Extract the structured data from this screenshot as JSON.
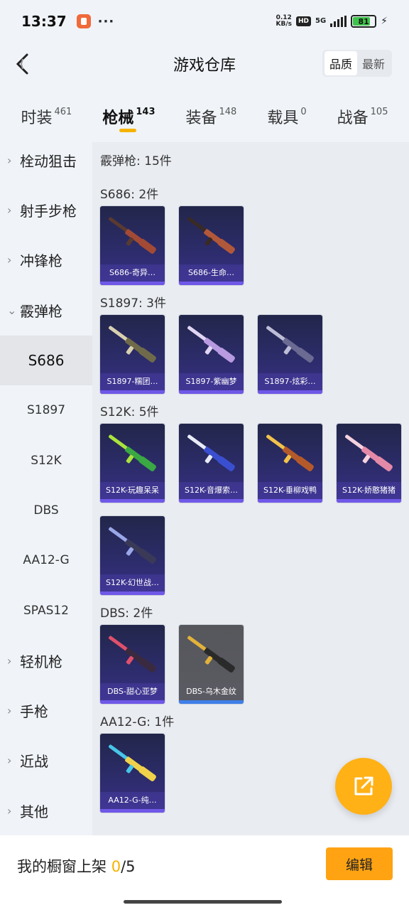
{
  "status_bar": {
    "time": "13:37",
    "dots": "···",
    "net_speed_value": "0.12",
    "net_speed_unit": "KB/s",
    "hd": "HD",
    "network": "5G",
    "battery": "81",
    "battery_level": 0.81,
    "bolt": "⚡"
  },
  "header": {
    "title": "游戏仓库",
    "sort_options": [
      "品质",
      "最新"
    ],
    "active_sort": 0
  },
  "tabs": [
    {
      "label": "时装",
      "count": "461"
    },
    {
      "label": "枪械",
      "count": "143"
    },
    {
      "label": "装备",
      "count": "148"
    },
    {
      "label": "载具",
      "count": "0"
    },
    {
      "label": "战备",
      "count": "105"
    }
  ],
  "sidebar": {
    "items": [
      {
        "label": "栓动狙击",
        "chevron": "›"
      },
      {
        "label": "射手步枪",
        "chevron": "›"
      },
      {
        "label": "冲锋枪",
        "chevron": "›"
      },
      {
        "label": "霰弹枪",
        "chevron": "⌄"
      },
      {
        "label": "S686"
      },
      {
        "label": "S1897"
      },
      {
        "label": "S12K"
      },
      {
        "label": "DBS"
      },
      {
        "label": "AA12-G"
      },
      {
        "label": "SPAS12"
      },
      {
        "label": "轻机枪",
        "chevron": "›"
      },
      {
        "label": "手枪",
        "chevron": "›"
      },
      {
        "label": "近战",
        "chevron": "›"
      },
      {
        "label": "其他",
        "chevron": "›"
      }
    ]
  },
  "content": {
    "category_heading": "霰弹枪: 15件",
    "groups": [
      {
        "heading": "S686: 2件",
        "items": [
          {
            "label": "S686-奇异…",
            "colors": [
              "#5a3a30",
              "#a24a35"
            ]
          },
          {
            "label": "S686-生命…",
            "colors": [
              "#3a2a24",
              "#b2583a"
            ]
          }
        ]
      },
      {
        "heading": "S1897: 3件",
        "items": [
          {
            "label": "S1897-糯团…",
            "colors": [
              "#d8d0b0",
              "#6f6a4a"
            ]
          },
          {
            "label": "S1897-紫幽梦",
            "colors": [
              "#e0d6f4",
              "#b89ae0"
            ]
          },
          {
            "label": "S1897-炫彩…",
            "colors": [
              "#bdbdd6",
              "#6b6a92"
            ]
          }
        ]
      },
      {
        "heading": "S12K: 5件",
        "items": [
          {
            "label": "S12K-玩趣呆呆",
            "colors": [
              "#a9e43c",
              "#3aa843"
            ]
          },
          {
            "label": "S12K-音爆索…",
            "colors": [
              "#e8ecf6",
              "#3a4fd0"
            ]
          },
          {
            "label": "S12K-垂柳戏鸭",
            "colors": [
              "#f2c24a",
              "#b45a2a"
            ]
          },
          {
            "label": "S12K-娇憨猪猪",
            "colors": [
              "#f6d2de",
              "#e48aa8"
            ]
          },
          {
            "label": "S12K-幻世战…",
            "colors": [
              "#9aa7e8",
              "#3a3a58"
            ]
          }
        ]
      },
      {
        "heading": "DBS: 2件",
        "items": [
          {
            "label": "DBS-甜心亚梦",
            "colors": [
              "#e0506a",
              "#3a2a40"
            ],
            "tone": "purple"
          },
          {
            "label": "DBS-乌木金纹",
            "colors": [
              "#e2b23a",
              "#2a2a2a"
            ],
            "tone": "gray"
          }
        ]
      },
      {
        "heading": "AA12-G: 1件",
        "items": [
          {
            "label": "AA12-G-纯…",
            "colors": [
              "#46c6e8",
              "#f0d24a"
            ]
          }
        ]
      }
    ]
  },
  "fab": {
    "icon": "share-out-icon"
  },
  "bottom_bar": {
    "label": "我的橱窗上架 ",
    "current": "0",
    "slash_total": "/5",
    "edit_label": "编辑"
  }
}
